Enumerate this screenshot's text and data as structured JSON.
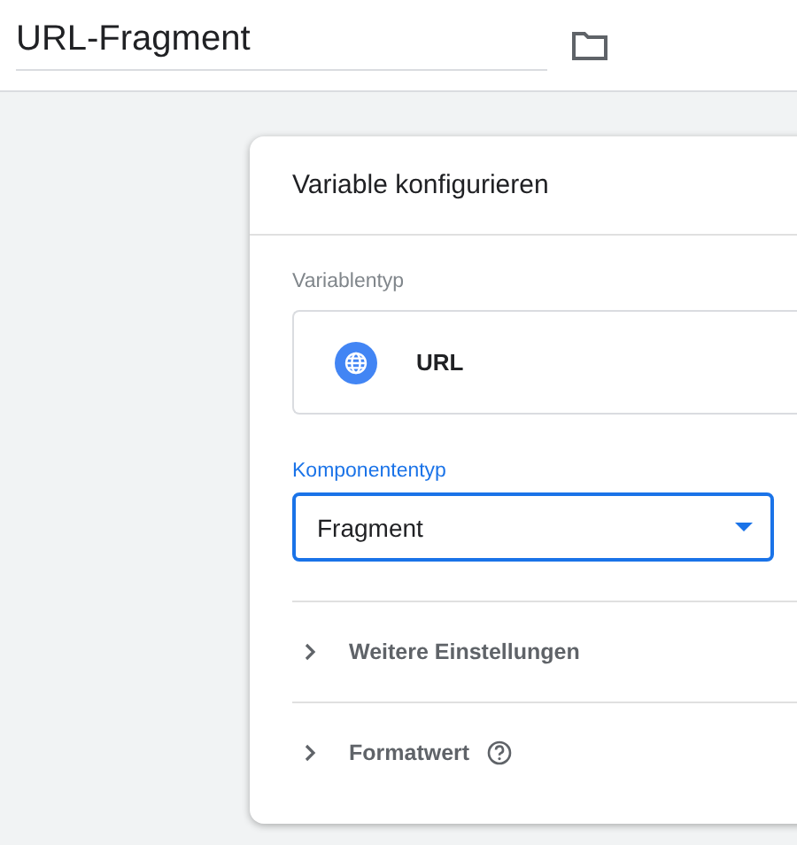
{
  "header": {
    "title": "URL-Fragment"
  },
  "card": {
    "title": "Variable konfigurieren",
    "variable_type": {
      "label": "Variablentyp",
      "value": "URL"
    },
    "component_type": {
      "label": "Komponententyp",
      "value": "Fragment",
      "focused": true
    },
    "sections": [
      {
        "label": "Weitere Einstellungen",
        "expanded": false,
        "help": false
      },
      {
        "label": "Formatwert",
        "expanded": false,
        "help": true
      }
    ]
  }
}
